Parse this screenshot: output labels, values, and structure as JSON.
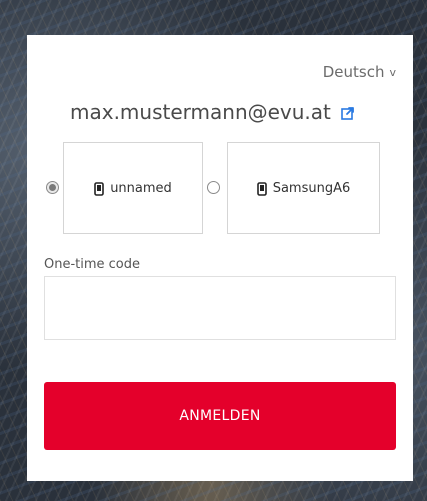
{
  "language": {
    "current": "Deutsch",
    "chevron": "v"
  },
  "user": {
    "email": "max.mustermann@evu.at",
    "change_icon": "external-link-icon"
  },
  "devices": [
    {
      "label": "unnamed",
      "icon": "phone-icon",
      "selected": true
    },
    {
      "label": "SamsungA6",
      "icon": "phone-icon",
      "selected": false
    }
  ],
  "otp": {
    "label": "One-time code",
    "value": "",
    "placeholder": ""
  },
  "submit": {
    "label": "ANMELDEN"
  },
  "colors": {
    "accent": "#e4002b",
    "link": "#2a7ae2"
  }
}
